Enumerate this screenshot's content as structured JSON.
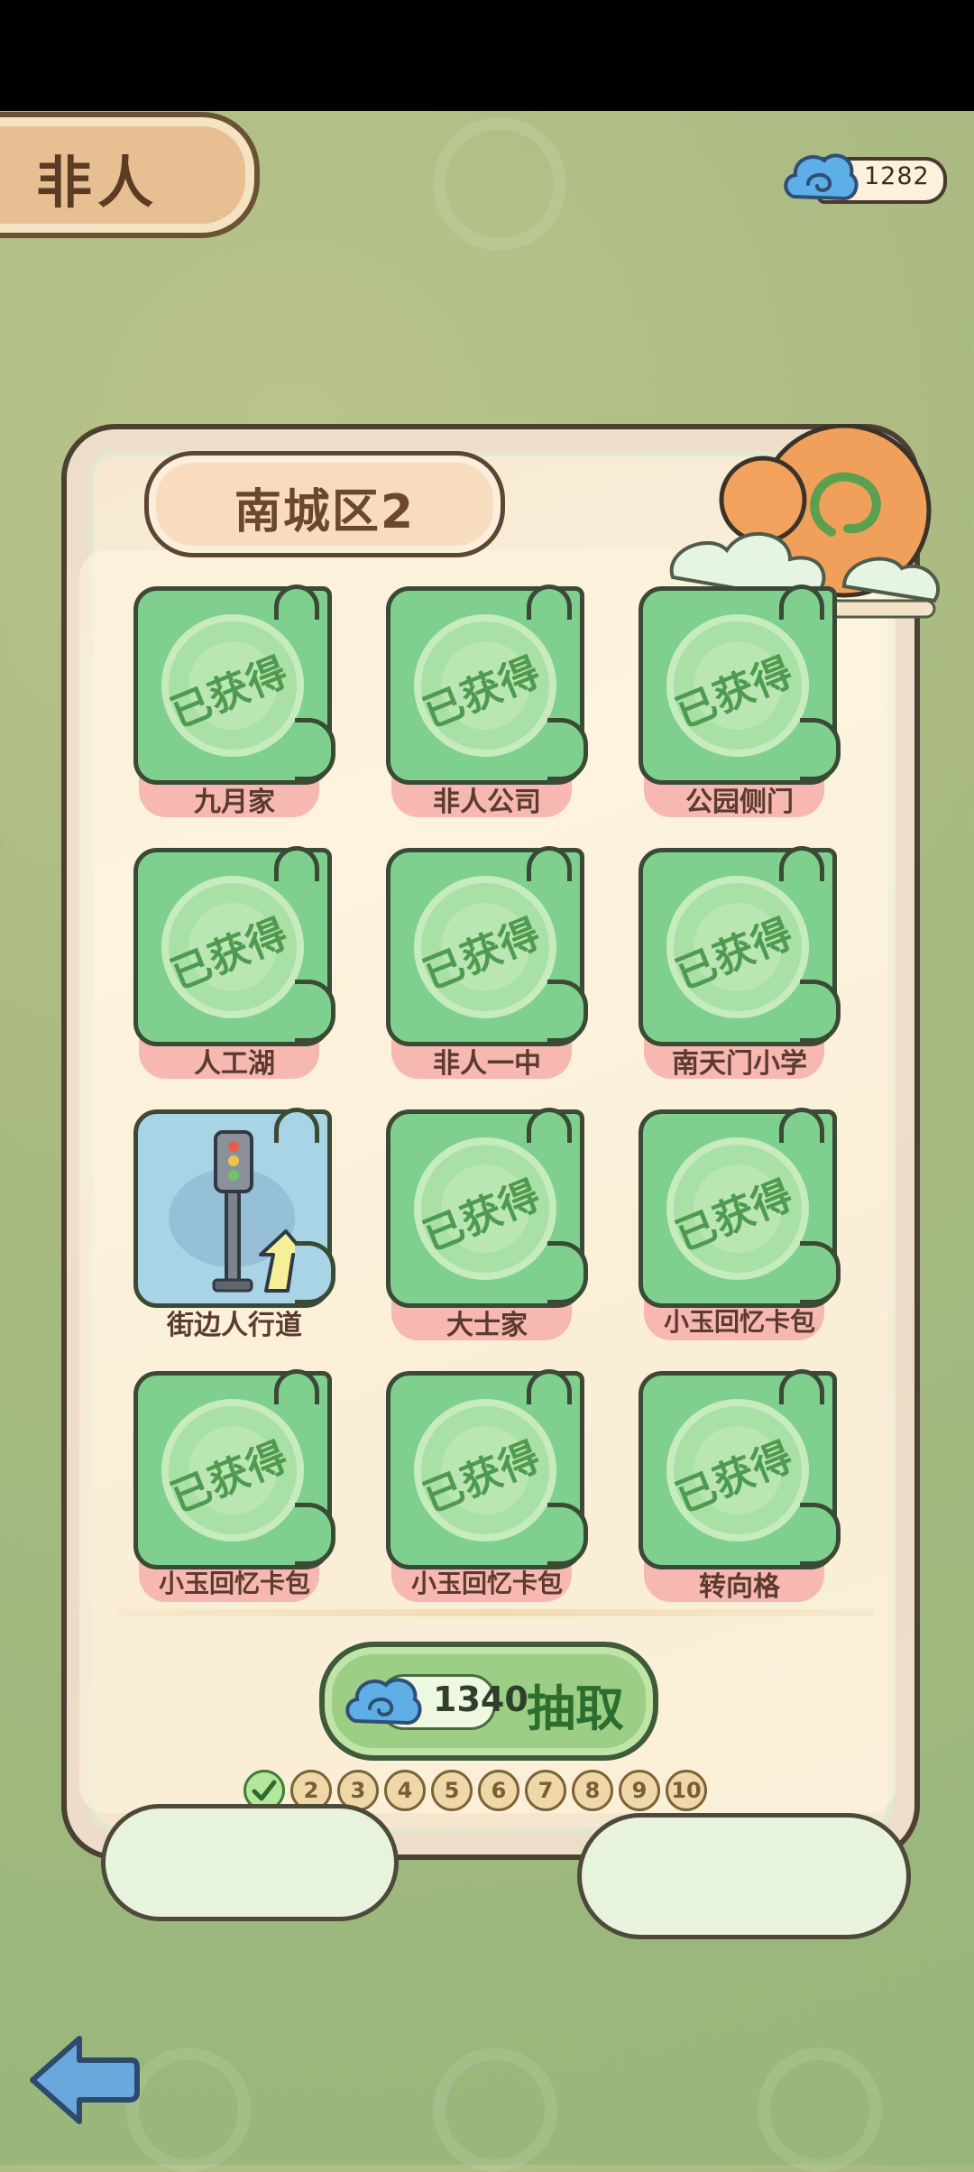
{
  "header": {
    "title": "非人",
    "currency_amount": "1282"
  },
  "board": {
    "district_name": "南城区2",
    "cards": [
      {
        "name": "九月家",
        "status": "已获得"
      },
      {
        "name": "非人公司",
        "status": "已获得"
      },
      {
        "name": "公园侧门",
        "status": "已获得"
      },
      {
        "name": "人工湖",
        "status": "已获得"
      },
      {
        "name": "非人一中",
        "status": "已获得"
      },
      {
        "name": "南天门小学",
        "status": "已获得"
      },
      {
        "name": "街边人行道",
        "status": ""
      },
      {
        "name": "大士家",
        "status": "已获得"
      },
      {
        "name": "小玉回忆卡包",
        "status": "已获得"
      },
      {
        "name": "小玉回忆卡包",
        "status": "已获得"
      },
      {
        "name": "小玉回忆卡包",
        "status": "已获得"
      },
      {
        "name": "转向格",
        "status": "已获得"
      }
    ],
    "draw": {
      "cost": "1340",
      "label": "抽取"
    },
    "pages": [
      "",
      "2",
      "3",
      "4",
      "5",
      "6",
      "7",
      "8",
      "9",
      "10"
    ],
    "current_page_done": true
  },
  "icons": {
    "currency": "cloud-coin-icon",
    "back": "back-arrow-icon",
    "check": "check-icon",
    "traffic_light": "traffic-light-icon"
  },
  "colors": {
    "card_obtained": "#7fcf8f",
    "card_locked": "#a9d4e6",
    "accent_green": "#2d6e2f"
  }
}
